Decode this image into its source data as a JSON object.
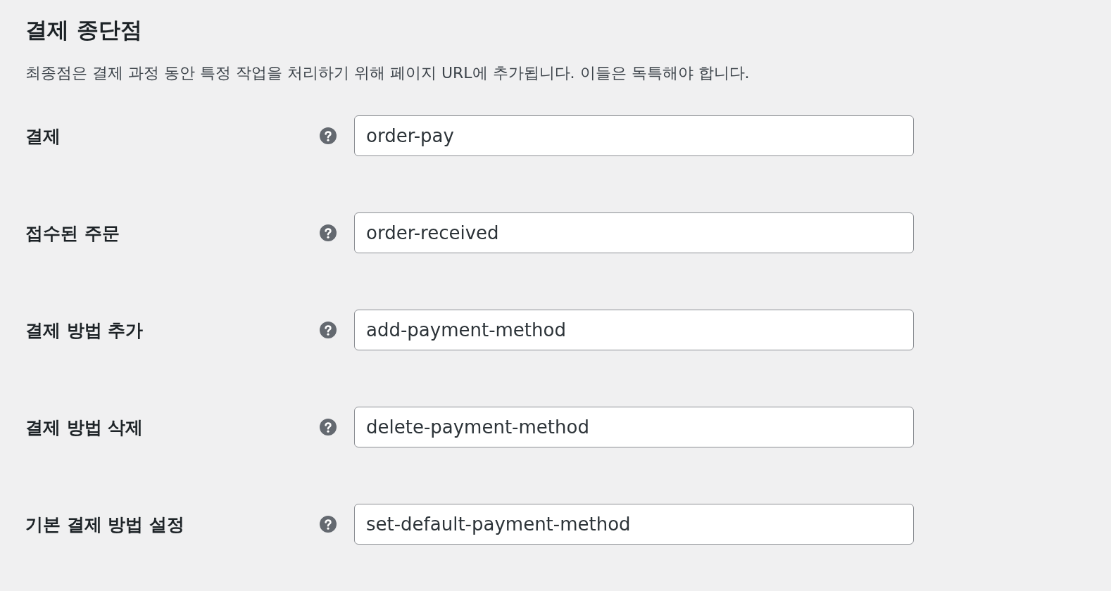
{
  "title": "결제 종단점",
  "description": "최종점은 결제 과정 동안 특정 작업을 처리하기 위해 페이지 URL에 추가됩니다. 이들은 독특해야 합니다.",
  "fields": [
    {
      "label": "결제",
      "value": "order-pay"
    },
    {
      "label": "접수된 주문",
      "value": "order-received"
    },
    {
      "label": "결제 방법 추가",
      "value": "add-payment-method"
    },
    {
      "label": "결제 방법 삭제",
      "value": "delete-payment-method"
    },
    {
      "label": "기본 결제 방법 설정",
      "value": "set-default-payment-method"
    }
  ]
}
